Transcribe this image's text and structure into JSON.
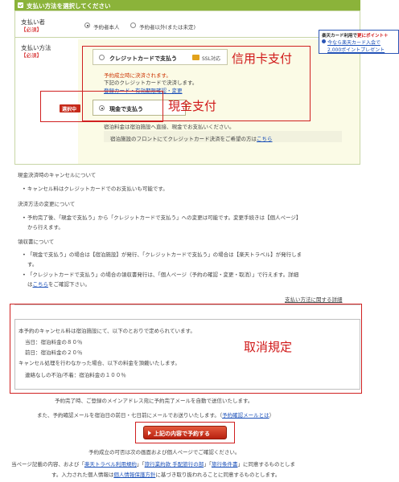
{
  "header": {
    "title": "支払い方法を選択してください"
  },
  "booker": {
    "label": "支払い者",
    "required": "【必須】",
    "option_self": "予約者本人",
    "option_other": "予約者以外(または未定)"
  },
  "payment": {
    "label": "支払い方法",
    "required": "【必須】",
    "credit": {
      "title": "クレジットカードで支払う",
      "ssl": "SSL対応",
      "note1": "予約成立時に決済されます。",
      "note2": "下記のクレジットカードで決済します。",
      "link": "登録カード・有効期限確認・変更"
    },
    "cash": {
      "badge": "選択中",
      "title": "現金で支払う",
      "note": "宿泊料金は宿泊施設へ直接、現金でお支払いください。",
      "frontdesk_prefix": "宿泊施設のフロントにてクレジットカード決済をご希望の方は",
      "frontdesk_link": "こちら"
    }
  },
  "promo": {
    "line1_a": "楽天カード利用で",
    "line1_b": "更にポイント＋",
    "line2": "今なら楽天カード入会で",
    "line3": "2,000ポイントプレゼント"
  },
  "annotations": {
    "credit": "信用卡支付",
    "cash": "現金支付",
    "cancel": "取消規定"
  },
  "notes": {
    "cancel_heading": "現金決済時のキャンセルについて",
    "cancel_item": "キャンセル料はクレジットカードでのお支払いも可能です。",
    "change_heading": "決済方法の変更について",
    "change_item1": "予約完了後、「現金で支払う」から「クレジットカードで支払う」への変更は可能です。変更手続きは【個人ページ】",
    "change_item2": "から行えます。",
    "receipt_heading": "領収書について",
    "receipt_item1": "「現金で支払う」の場合は【宿泊施設】が発行、「クレジットカードで支払う」の場合は【楽天トラベル】が発行しま",
    "receipt_item1b": "す。",
    "receipt_item2": "「クレジットカードで支払う」の場合の領収書発行は、「個人ページ（予約の確認・変更・取消）」で行えます。詳細",
    "receipt_item2b_prefix": "は",
    "receipt_item2b_link": "こちら",
    "receipt_item2b_suffix": "をご確認下さい。",
    "detail_link": "支払い方法に関する詳細"
  },
  "cancel_policy": {
    "intro": "本予約のキャンセル料は宿泊施設にて、以下のとおりで定められています。",
    "day_of": "当日：宿泊料金の８０％",
    "day_before": "前日：宿泊料金の２０％",
    "noshow_intro": "キャンセル処理を行わなかった場合、以下の料金を頂戴いたします。",
    "noshow": "連絡なしの不泊/不着：宿泊料金の１００％"
  },
  "footer": {
    "mail1": "予約完了時、ご登録のメインアドレス宛に予約完了メールを自動で送信いたします。",
    "mail2_prefix": "また、予約確認メールを宿泊日の前日・七日前にメールでお送りいたします。（",
    "mail2_link": "予約確認メールとは",
    "mail2_suffix": "）",
    "submit": "上記の内容で予約する",
    "confirm_note": "予約成立の可否は次の画面および個人ページでご確認ください。",
    "terms1_a": "当ページ記載の内容、および「",
    "terms1_link1": "楽天トラベル利用規約",
    "terms1_b": "」「",
    "terms1_link2": "旅行業約款 手配旅行の部",
    "terms1_c": "」「",
    "terms1_link3": "旅行条件書",
    "terms1_d": "」に同意するものとしま",
    "terms2_a": "す。入力された個人情報は",
    "terms2_link": "個人情報保護方針",
    "terms2_b": "に基づき取り扱われることに同意するものとします。"
  },
  "colors": {
    "accent": "#8bb33a",
    "annotation": "#d01818",
    "link": "#1a4fb8",
    "button": "#c8321a"
  }
}
